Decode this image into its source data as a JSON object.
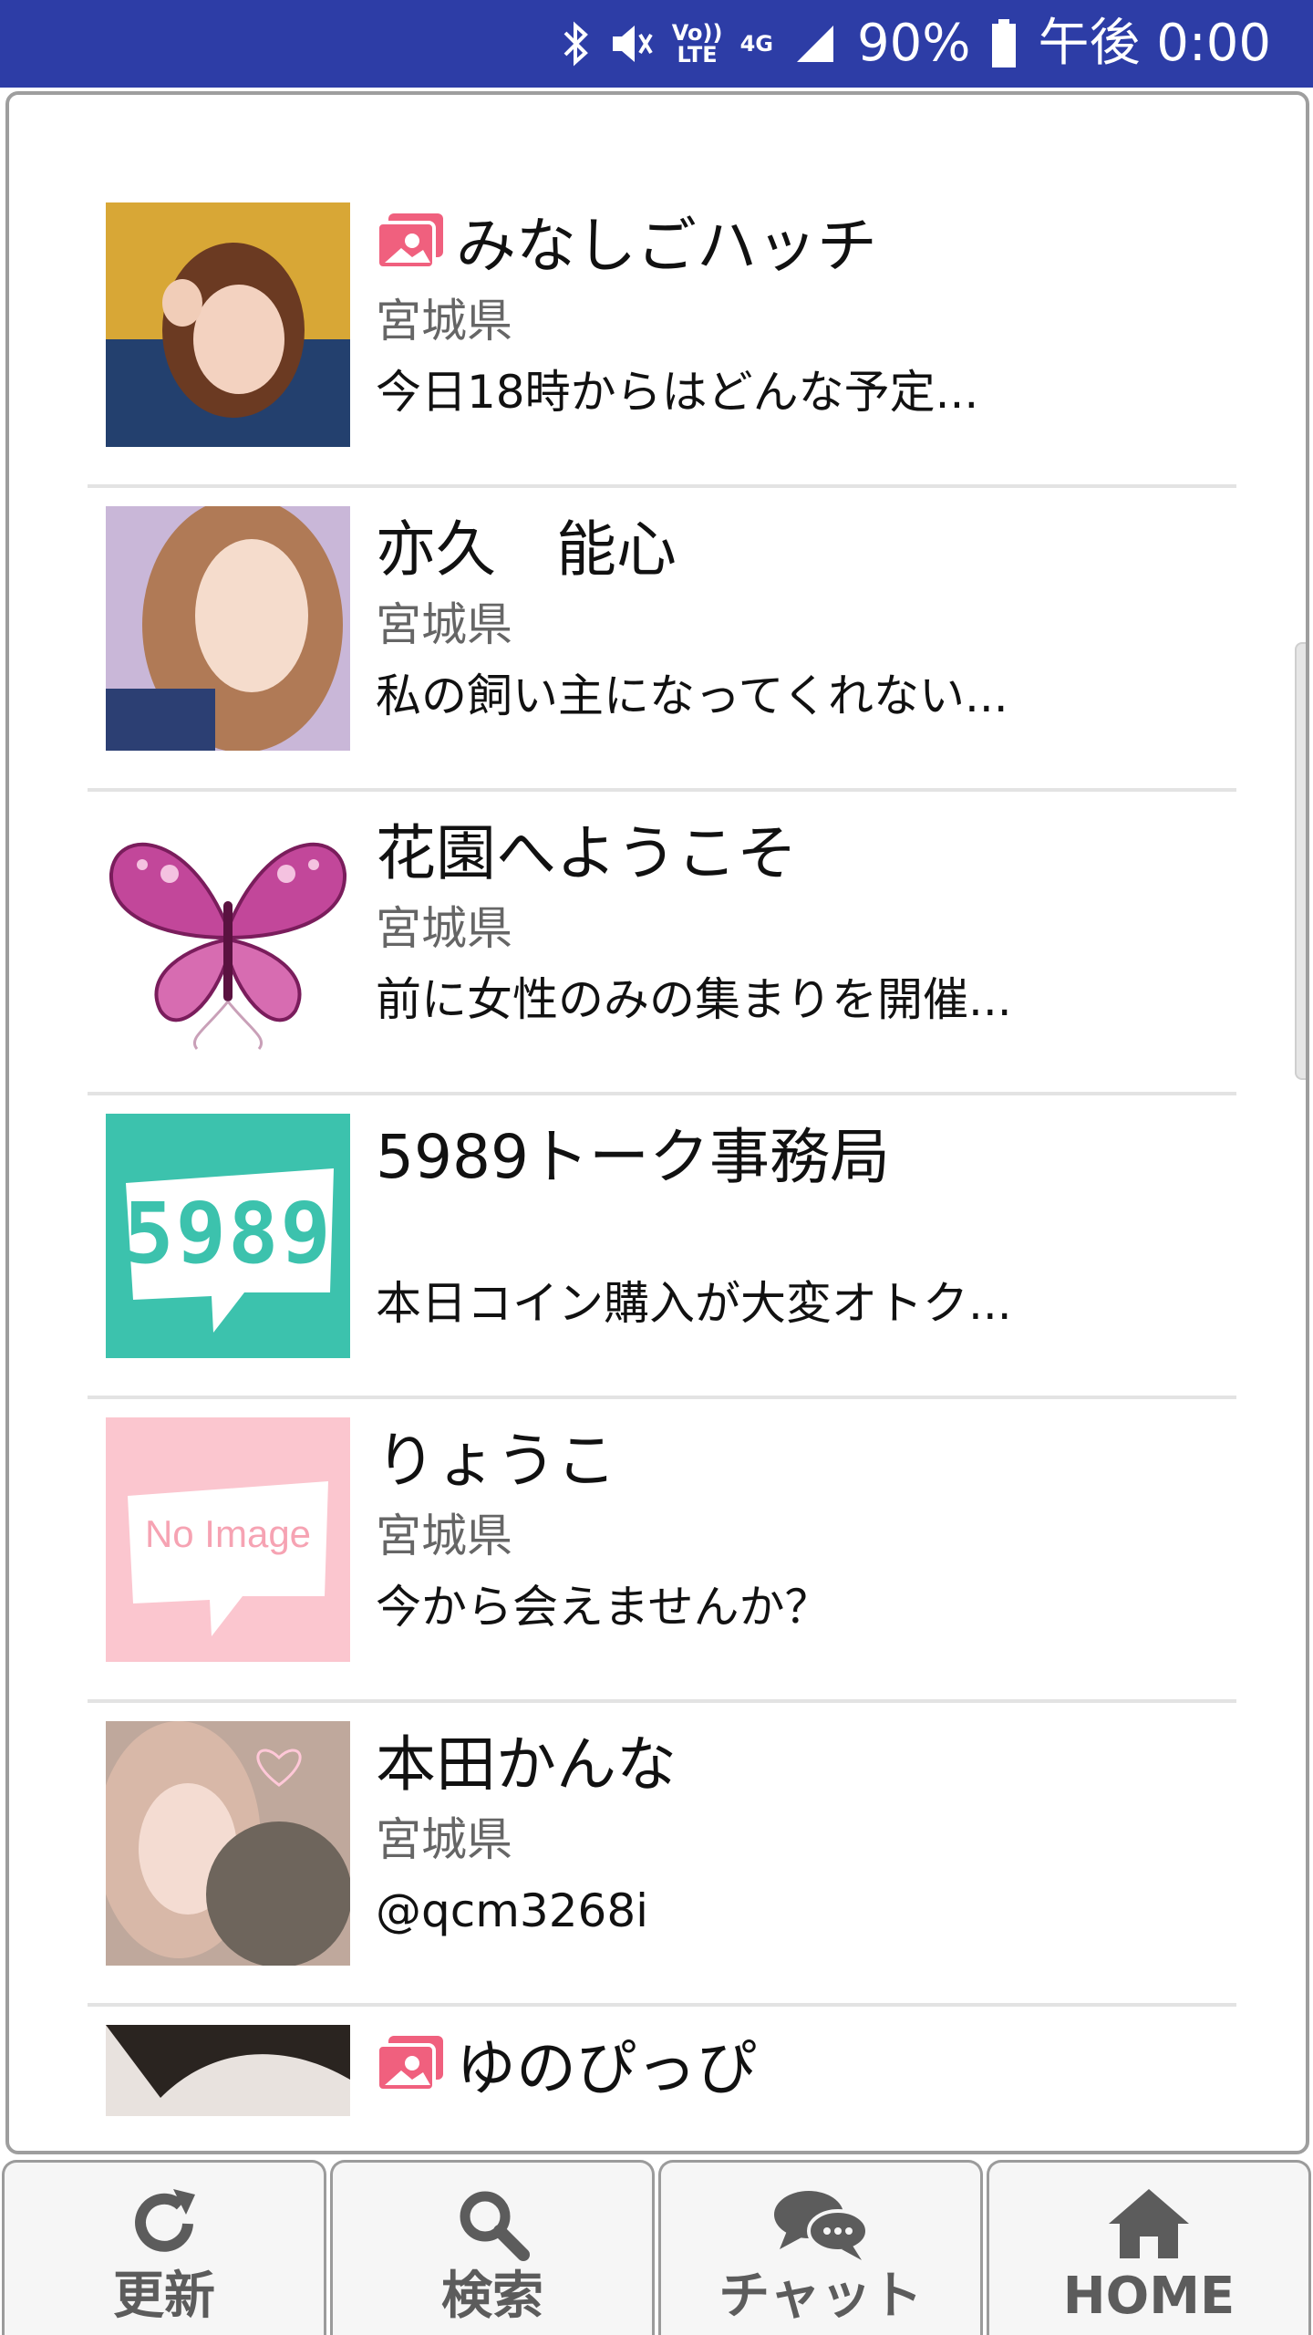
{
  "status_bar": {
    "network": "4G",
    "volte": "Vo)) LTE",
    "battery": "90%",
    "time": "午後 0:00"
  },
  "contacts": [
    {
      "name": "みなしごハッチ",
      "has_photo_badge": true,
      "prefecture": "宮城県",
      "message": "今日18時からはどんな予定..."
    },
    {
      "name": "亦久　能心",
      "has_photo_badge": false,
      "prefecture": "宮城県",
      "message": "私の飼い主になってくれない..."
    },
    {
      "name": "花園へようこそ",
      "has_photo_badge": false,
      "prefecture": "宮城県",
      "message": "前に女性のみの集まりを開催..."
    },
    {
      "name": "5989トーク事務局",
      "has_photo_badge": false,
      "prefecture": "",
      "message": "本日コイン購入が大変オトク..."
    },
    {
      "name": "りょうこ",
      "has_photo_badge": false,
      "prefecture": "宮城県",
      "message": "今から会えませんか？"
    },
    {
      "name": "本田かんな",
      "has_photo_badge": false,
      "prefecture": "宮城県",
      "message": "@qcm3268i"
    },
    {
      "name": "ゆのぴっぴ",
      "has_photo_badge": true,
      "prefecture": "",
      "message": ""
    }
  ],
  "avatar_labels": {
    "talk_logo": "5989",
    "no_image": "No Image"
  },
  "tabs": [
    {
      "label": "更新",
      "icon": "refresh-icon"
    },
    {
      "label": "検索",
      "icon": "search-icon"
    },
    {
      "label": "チャット",
      "icon": "chat-icon"
    },
    {
      "label": "HOME",
      "icon": "home-icon"
    }
  ],
  "colors": {
    "status_bar": "#2d3da6",
    "badge_pink": "#f0607e",
    "tab_text": "#5c5c5c"
  }
}
